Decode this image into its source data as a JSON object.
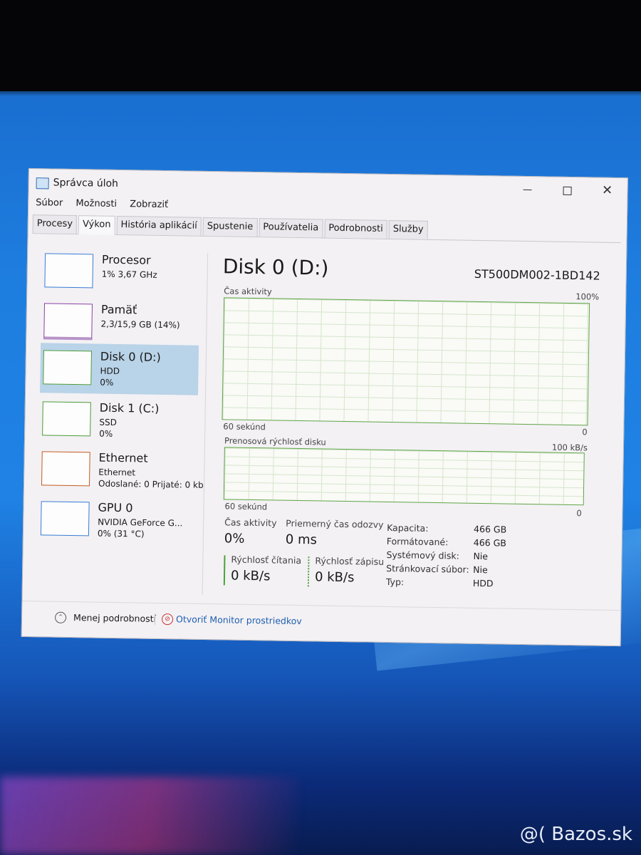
{
  "window": {
    "title": "Správca úloh",
    "controls": {
      "minimize": "",
      "maximize": "",
      "close": "✕"
    }
  },
  "menu": [
    "Súbor",
    "Možnosti",
    "Zobraziť"
  ],
  "tabs": [
    {
      "label": "Procesy",
      "active": false
    },
    {
      "label": "Výkon",
      "active": true
    },
    {
      "label": "História aplikácií",
      "active": false
    },
    {
      "label": "Spustenie",
      "active": false
    },
    {
      "label": "Používatelia",
      "active": false
    },
    {
      "label": "Podrobnosti",
      "active": false
    },
    {
      "label": "Služby",
      "active": false
    }
  ],
  "sidebar": [
    {
      "name": "Procesor",
      "line1": "1% 3,67 GHz",
      "line2": "",
      "color": "#3a7bd5",
      "selected": false
    },
    {
      "name": "Pamäť",
      "line1": "2,3/15,9 GB (14%)",
      "line2": "",
      "color": "#8a3fa6",
      "selected": false
    },
    {
      "name": "Disk 0 (D:)",
      "line1": "HDD",
      "line2": "0%",
      "color": "#4a9a38",
      "selected": true
    },
    {
      "name": "Disk 1 (C:)",
      "line1": "SSD",
      "line2": "0%",
      "color": "#4a9a38",
      "selected": false
    },
    {
      "name": "Ethernet",
      "line1": "Ethernet",
      "line2": "Odoslané: 0 Prijaté: 0 kb",
      "color": "#c25b1e",
      "selected": false
    },
    {
      "name": "GPU 0",
      "line1": "NVIDIA GeForce G...",
      "line2": "0% (31 °C)",
      "color": "#3a7bd5",
      "selected": false
    }
  ],
  "main": {
    "title": "Disk 0 (D:)",
    "model": "ST500DM002-1BD142",
    "graph1": {
      "label": "Čas aktivity",
      "max": "100%",
      "time": "60 sekúnd",
      "min": "0"
    },
    "graph2": {
      "label": "Prenosová rýchlosť disku",
      "max": "100 kB/s",
      "time": "60 sekúnd",
      "min": "0"
    },
    "stats": {
      "activity_label": "Čas aktivity",
      "activity_value": "0%",
      "response_label": "Priemerný čas odozvy",
      "response_value": "0 ms",
      "read_label": "Rýchlosť čítania",
      "read_value": "0 kB/s",
      "write_label": "Rýchlosť zápisu",
      "write_value": "0 kB/s"
    },
    "details": [
      {
        "key": "Kapacita:",
        "value": "466 GB"
      },
      {
        "key": "Formátované:",
        "value": "466 GB"
      },
      {
        "key": "Systémový disk:",
        "value": "Nie"
      },
      {
        "key": "Stránkovací súbor:",
        "value": "Nie"
      },
      {
        "key": "Typ:",
        "value": "HDD"
      }
    ]
  },
  "footer": {
    "less_details": "Menej podrobností",
    "resource_monitor": "Otvoriť Monitor prostriedkov"
  },
  "watermark": "@( Bazos.sk"
}
